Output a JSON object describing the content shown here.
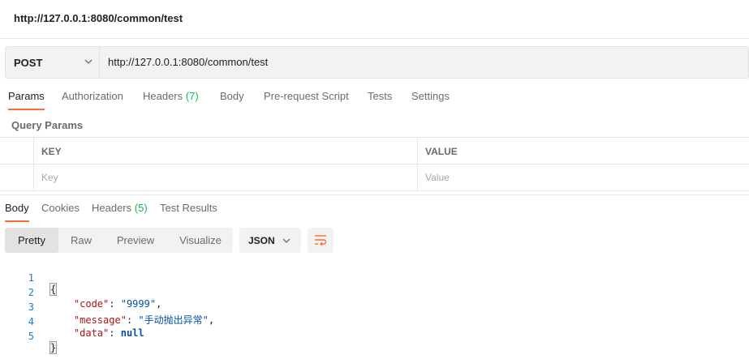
{
  "title": "http://127.0.0.1:8080/common/test",
  "request": {
    "method": "POST",
    "url": "http://127.0.0.1:8080/common/test"
  },
  "request_tabs": [
    {
      "label": "Params",
      "active": true
    },
    {
      "label": "Authorization"
    },
    {
      "label": "Headers",
      "count": "(7)"
    },
    {
      "label": "Body"
    },
    {
      "label": "Pre-request Script"
    },
    {
      "label": "Tests"
    },
    {
      "label": "Settings"
    }
  ],
  "query_params": {
    "title": "Query Params",
    "columns": [
      "KEY",
      "VALUE"
    ],
    "placeholders": [
      "Key",
      "Value"
    ]
  },
  "response_tabs": [
    {
      "label": "Body",
      "active": true
    },
    {
      "label": "Cookies"
    },
    {
      "label": "Headers",
      "count": "(5)"
    },
    {
      "label": "Test Results"
    }
  ],
  "view_modes": [
    "Pretty",
    "Raw",
    "Preview",
    "Visualize"
  ],
  "active_view": "Pretty",
  "format": "JSON",
  "response_body": {
    "line_numbers": [
      "1",
      "2",
      "3",
      "4",
      "5"
    ],
    "open": "{",
    "close": "}",
    "entries": [
      {
        "key": "\"code\"",
        "sep": ": ",
        "value": "\"9999\"",
        "tail": ","
      },
      {
        "key": "\"message\"",
        "sep": ": ",
        "value": "\"手动抛出异常\"",
        "tail": ","
      },
      {
        "key": "\"data\"",
        "sep": ": ",
        "value": "null",
        "tail": ""
      }
    ]
  },
  "colors": {
    "accent": "#ff6c37",
    "count_green": "#0cbb52",
    "json_key": "#a31515",
    "json_string": "#0451a5",
    "line_number": "#1a7ac9"
  }
}
